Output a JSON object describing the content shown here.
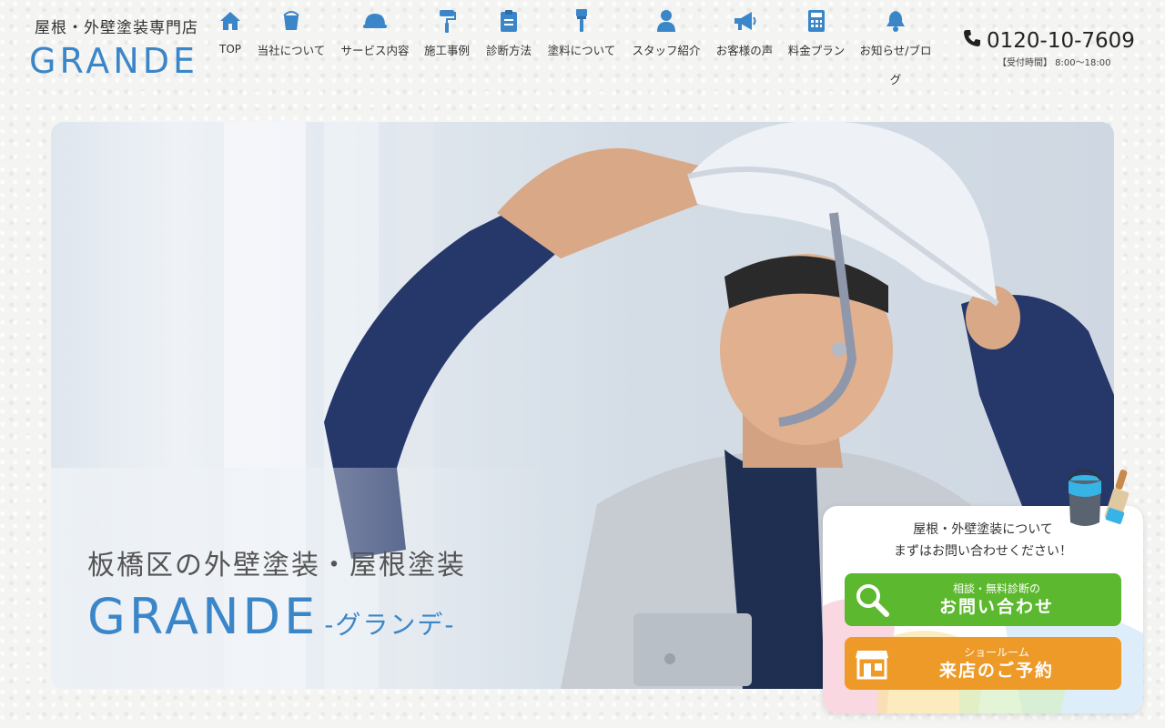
{
  "logo": {
    "sub": "屋根・外壁塗装専門店",
    "main": "GRANDE"
  },
  "nav": [
    {
      "label": "TOP",
      "icon": "home-icon"
    },
    {
      "label": "当社について",
      "icon": "bucket-icon"
    },
    {
      "label": "サービス内容",
      "icon": "helmet-icon"
    },
    {
      "label": "施工事例",
      "icon": "paint-roller-icon"
    },
    {
      "label": "診断方法",
      "icon": "clipboard-icon"
    },
    {
      "label": "塗料について",
      "icon": "paint-brush-icon"
    },
    {
      "label": "スタッフ紹介",
      "icon": "person-icon"
    },
    {
      "label": "お客様の声",
      "icon": "megaphone-icon"
    },
    {
      "label": "料金プラン",
      "icon": "calculator-icon"
    },
    {
      "label": "お知らせ/ブログ",
      "icon": "bell-icon"
    }
  ],
  "phone": {
    "number": "0120-10-7609",
    "hours": "【受付時間】 8:00〜18:00"
  },
  "hero": {
    "tagline": "板橋区の外壁塗装・屋根塗装",
    "brand": "GRANDE",
    "brand_sub": "-グランデ-"
  },
  "cta": {
    "line1": "屋根・外壁塗装について",
    "line2": "まずはお問い合わせください！",
    "contact_small": "相談・無料診断の",
    "contact_large": "お問い合わせ",
    "visit_small": "ショールーム",
    "visit_large": "来店のご予約"
  },
  "colors": {
    "accent": "#3a86c8",
    "green": "#5cb82e",
    "orange": "#ed9a28"
  }
}
